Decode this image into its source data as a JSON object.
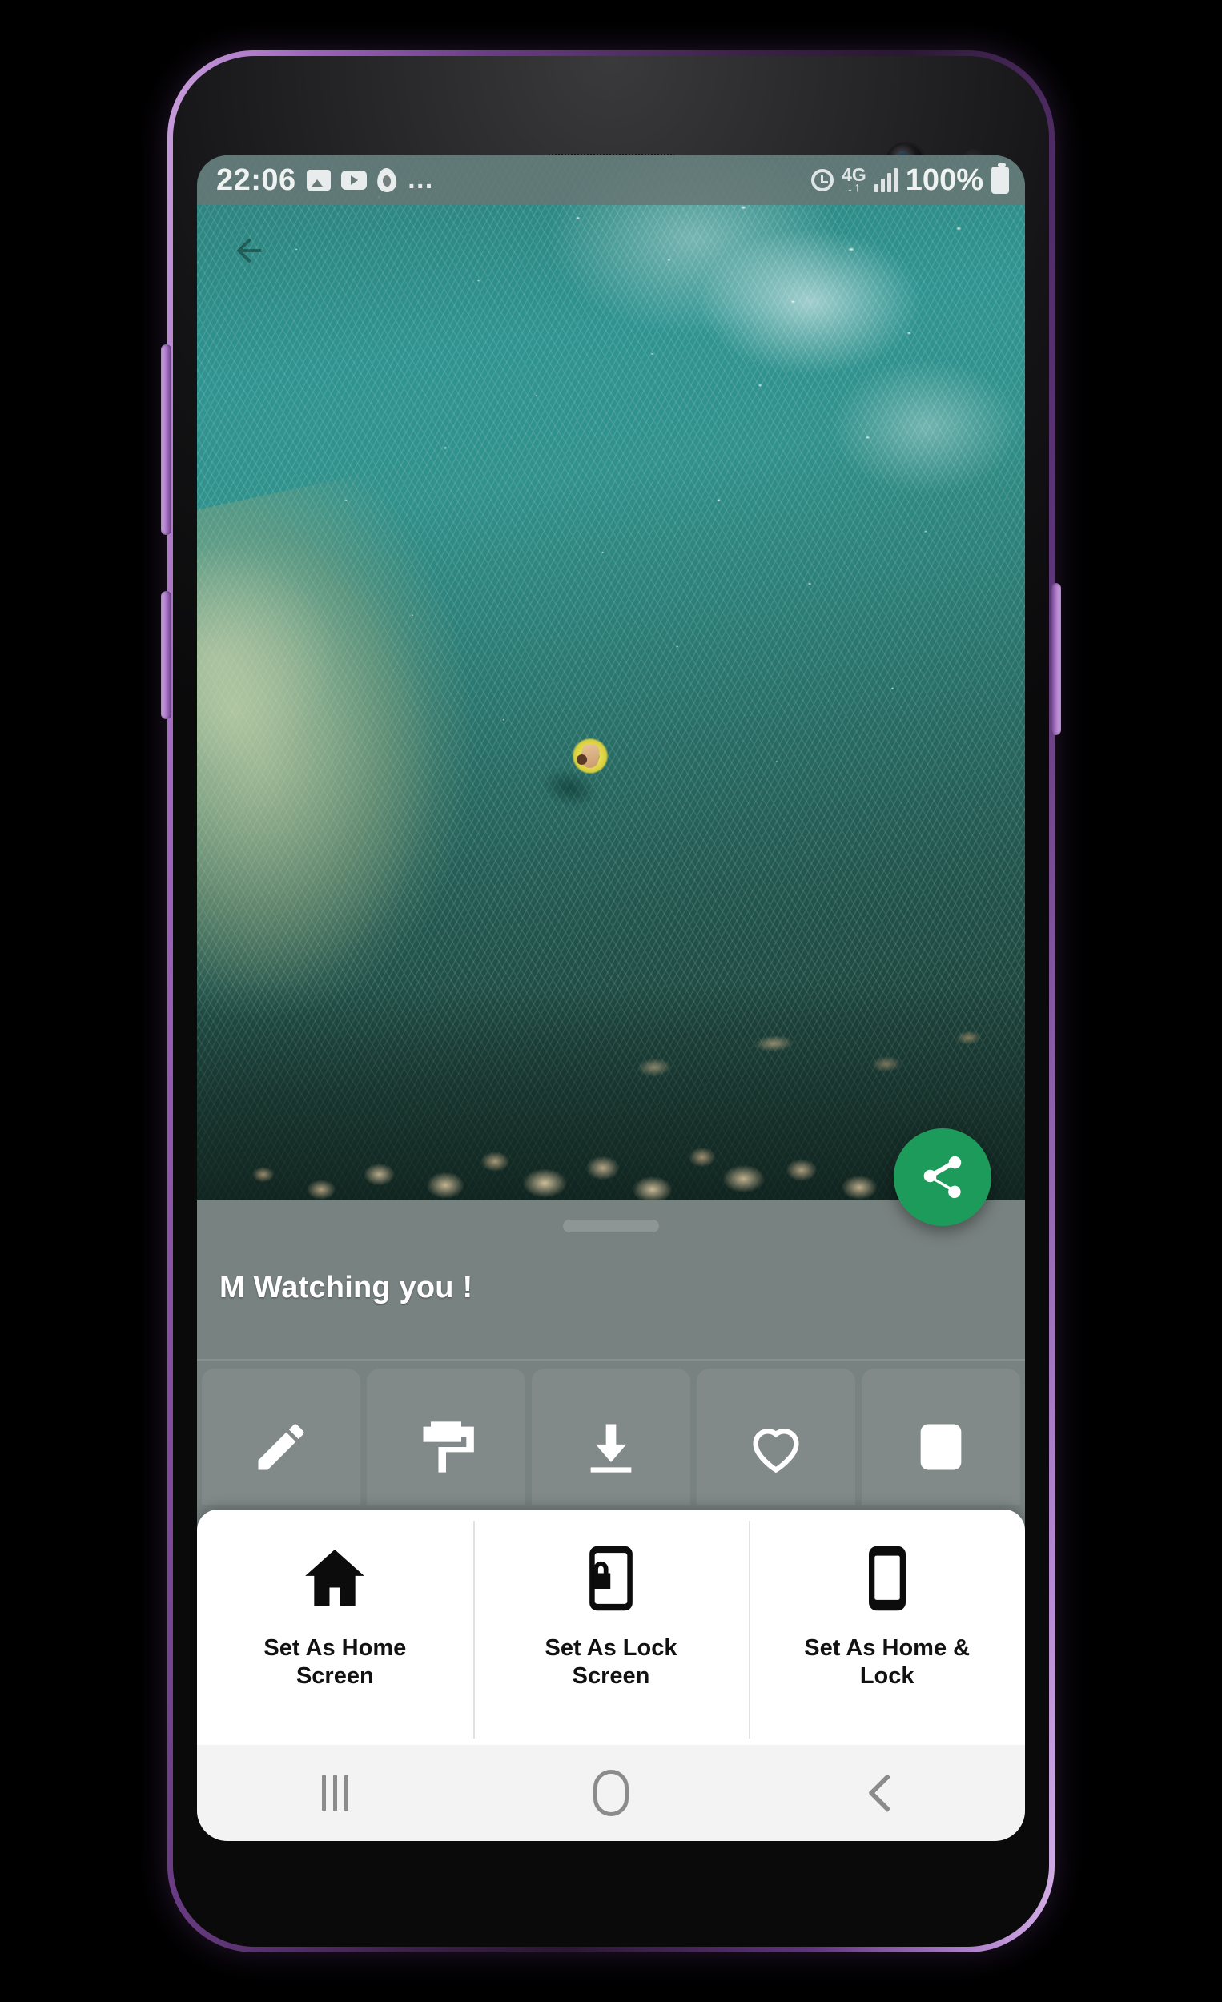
{
  "statusbar": {
    "time": "22:06",
    "battery_percent": "100%",
    "network": "4G",
    "overflow": "…",
    "icons": [
      "gallery-icon",
      "youtube-icon",
      "fire-icon",
      "overflow-dots-icon",
      "alarm-icon",
      "network-4g-icon",
      "signal-bars-icon",
      "battery-icon"
    ]
  },
  "wallpaper": {
    "title": "M Watching you !",
    "description": "Aerial photo of a person floating on a yellow ring in clear turquoise sea water with rocky shoreline",
    "back_label": "Back"
  },
  "fab": {
    "label": "Share",
    "icon": "share-icon",
    "color": "#1d9b5b"
  },
  "actions": [
    {
      "name": "edit",
      "icon": "pencil-icon"
    },
    {
      "name": "apply",
      "icon": "paint-roller-icon"
    },
    {
      "name": "download",
      "icon": "download-icon"
    },
    {
      "name": "favorite",
      "icon": "heart-icon"
    },
    {
      "name": "preview",
      "icon": "crop-icon"
    }
  ],
  "dialog": {
    "options": [
      {
        "label": "Set As Home Screen",
        "icon": "home-icon"
      },
      {
        "label": "Set As Lock Screen",
        "icon": "phone-lock-icon"
      },
      {
        "label": "Set As Home & Lock",
        "icon": "phone-icon"
      }
    ]
  },
  "navbar": {
    "recents_label": "Recents",
    "home_label": "Home",
    "back_label": "Back"
  }
}
